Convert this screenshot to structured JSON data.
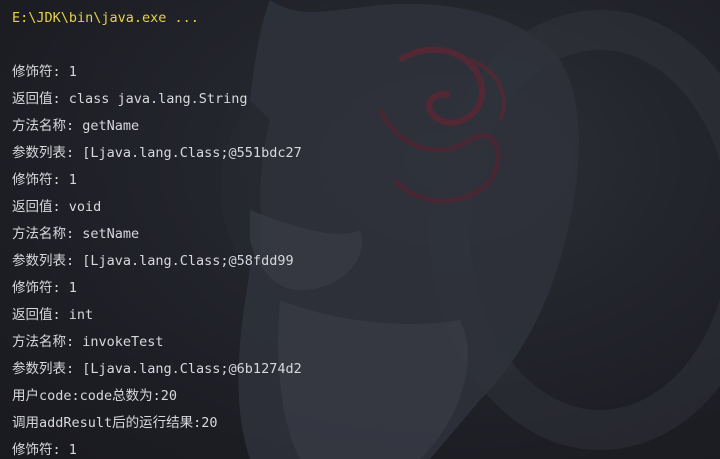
{
  "console": {
    "command_line": "E:\\JDK\\bin\\java.exe ...",
    "output": [
      "修饰符: 1",
      "返回值: class java.lang.String",
      "方法名称: getName",
      "参数列表: [Ljava.lang.Class;@551bdc27",
      "修饰符: 1",
      "返回值: void",
      "方法名称: setName",
      "参数列表: [Ljava.lang.Class;@58fdd99",
      "修饰符: 1",
      "返回值: int",
      "方法名称: invokeTest",
      "参数列表: [Ljava.lang.Class;@6b1274d2",
      "用户code:code总数为:20",
      "调用addResult后的运行结果:20",
      "修饰符: 1"
    ]
  },
  "colors": {
    "command_text": "#e6d04a",
    "output_text": "#d6d8dc",
    "background": "#1e1f22"
  }
}
